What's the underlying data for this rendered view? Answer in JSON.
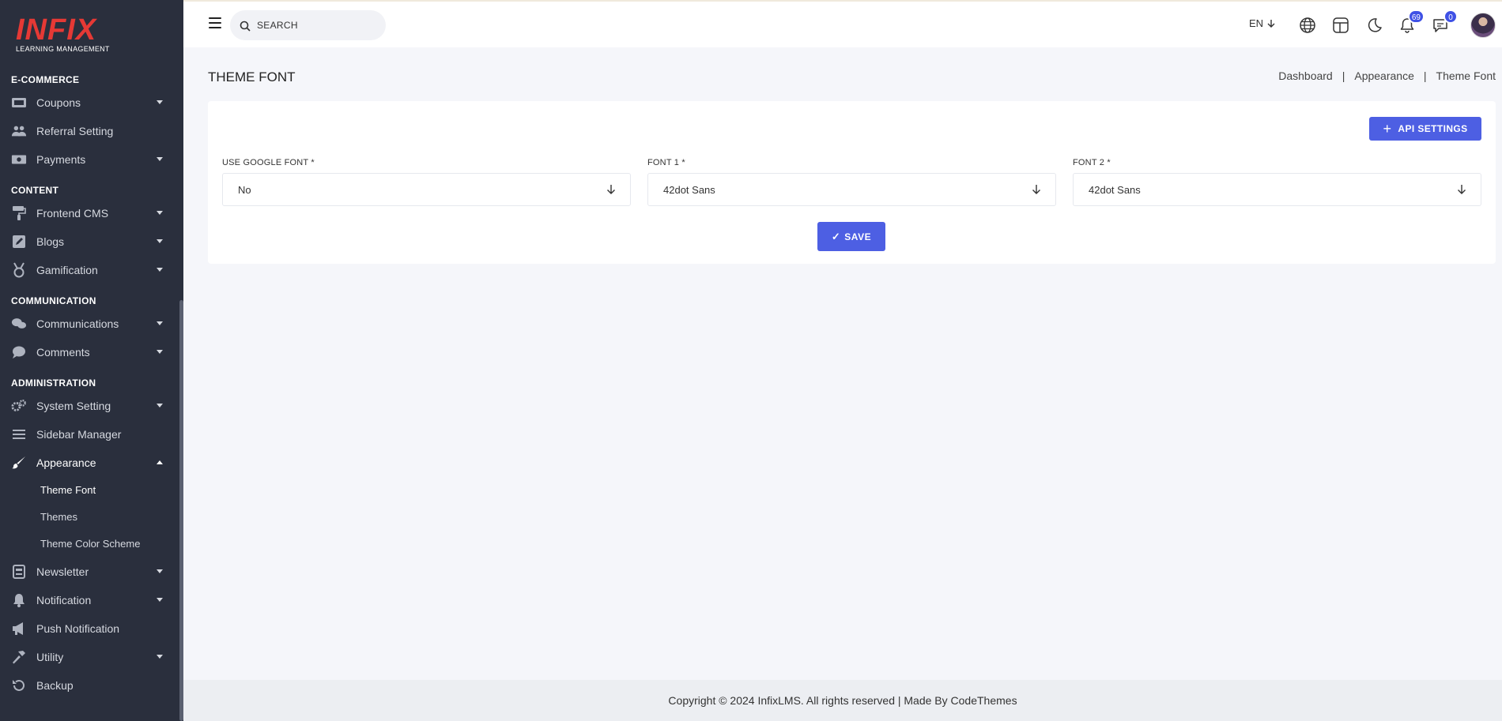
{
  "brand": {
    "logo_text": "INFIX",
    "logo_subtext": "LEARNING MANAGEMENT",
    "logo_color": "#e53935"
  },
  "sidebar": {
    "sections": [
      {
        "title": "E-COMMERCE",
        "items": [
          {
            "label": "Coupons",
            "icon": "ticket-icon",
            "has_caret": true
          },
          {
            "label": "Referral Setting",
            "icon": "users-icon",
            "has_caret": false
          },
          {
            "label": "Payments",
            "icon": "money-icon",
            "has_caret": true
          }
        ]
      },
      {
        "title": "CONTENT",
        "items": [
          {
            "label": "Frontend CMS",
            "icon": "paint-roller-icon",
            "has_caret": true
          },
          {
            "label": "Blogs",
            "icon": "edit-icon",
            "has_caret": true
          },
          {
            "label": "Gamification",
            "icon": "medal-icon",
            "has_caret": true
          }
        ]
      },
      {
        "title": "COMMUNICATION",
        "items": [
          {
            "label": "Communications",
            "icon": "chat-bubbles-icon",
            "has_caret": true
          },
          {
            "label": "Comments",
            "icon": "comment-icon",
            "has_caret": true
          }
        ]
      },
      {
        "title": "ADMINISTRATION",
        "items": [
          {
            "label": "System Setting",
            "icon": "gears-icon",
            "has_caret": true
          },
          {
            "label": "Sidebar Manager",
            "icon": "list-icon",
            "has_caret": false
          },
          {
            "label": "Appearance",
            "icon": "brush-icon",
            "has_caret": true,
            "expanded": true,
            "children": [
              "Theme Font",
              "Themes",
              "Theme Color Scheme"
            ]
          },
          {
            "label": "Newsletter",
            "icon": "newsletter-icon",
            "has_caret": true
          },
          {
            "label": "Notification",
            "icon": "bell-icon",
            "has_caret": true
          },
          {
            "label": "Push Notification",
            "icon": "megaphone-icon",
            "has_caret": false
          },
          {
            "label": "Utility",
            "icon": "hammer-icon",
            "has_caret": true
          },
          {
            "label": "Backup",
            "icon": "history-icon",
            "has_caret": false
          }
        ]
      }
    ],
    "active_item": "Appearance",
    "active_child": "Theme Font"
  },
  "header": {
    "search_placeholder": "SEARCH",
    "language": "EN",
    "notifications_count": "69",
    "messages_count": "0"
  },
  "page": {
    "title": "THEME FONT",
    "breadcrumb": [
      "Dashboard",
      "Appearance",
      "Theme Font"
    ]
  },
  "form": {
    "api_button_label": "API SETTINGS",
    "fields": [
      {
        "label": "USE GOOGLE FONT *",
        "value": "No"
      },
      {
        "label": "FONT 1 *",
        "value": "42dot Sans"
      },
      {
        "label": "FONT 2 *",
        "value": "42dot Sans"
      }
    ],
    "save_label": "SAVE"
  },
  "footer": {
    "text": "Copyright © 2024 InfixLMS. All rights reserved | Made By CodeThemes"
  },
  "colors": {
    "sidebar_bg": "#2a2f3d",
    "accent": "#4d5fe3",
    "page_bg": "#f5f6fa"
  }
}
